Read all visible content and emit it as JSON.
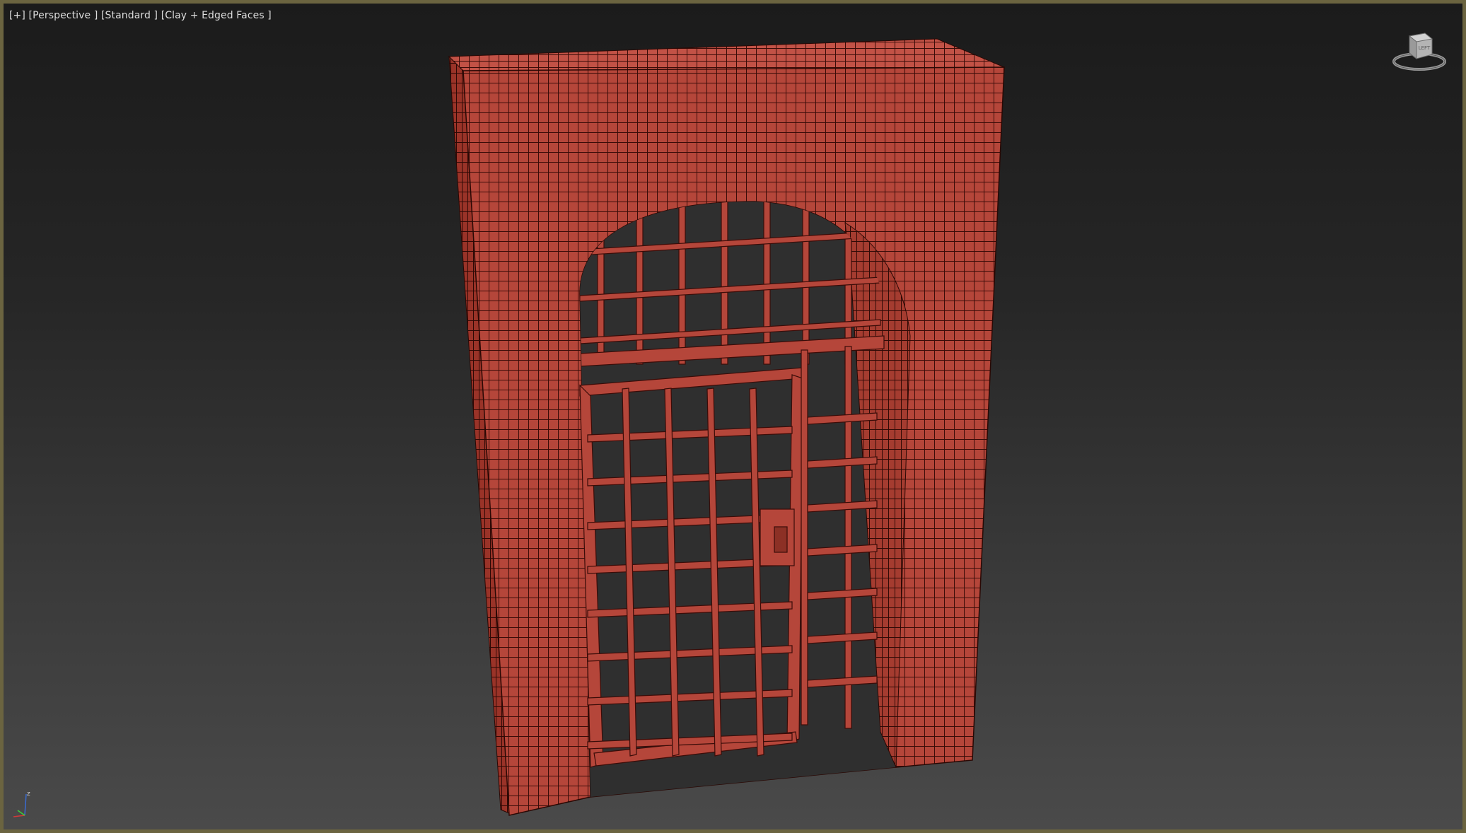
{
  "viewport": {
    "labels": {
      "menu": "[+]",
      "view": "[Perspective ]",
      "shading_preset": "[Standard ]",
      "shading_mode": "[Clay + Edged Faces ]"
    },
    "viewcube_face": "LEFT",
    "axis_z_label": "z",
    "colors": {
      "frame_border": "#6b6440",
      "model_clay": "#b5463a",
      "wire_edges": "#3a0c08",
      "background_top": "#1b1b1b",
      "background_bottom": "#4a4a4a"
    }
  },
  "model": {
    "name": "arched-portcullis-gate",
    "material": "clay"
  }
}
